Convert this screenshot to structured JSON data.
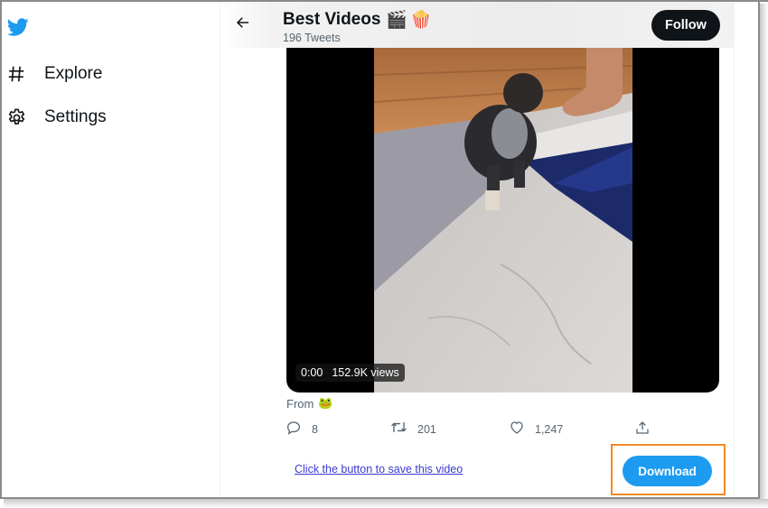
{
  "sidebar": {
    "logo": "twitter-bird-icon",
    "items": [
      {
        "label": "Explore",
        "icon": "hashtag-icon"
      },
      {
        "label": "Settings",
        "icon": "gear-icon"
      }
    ]
  },
  "header": {
    "back_icon": "arrow-left-icon",
    "title": "Best Videos",
    "title_emoji": [
      "🎬",
      "🍿"
    ],
    "subtitle": "196 Tweets",
    "follow_label": "Follow"
  },
  "video": {
    "time": "0:00",
    "views": "152.9K views"
  },
  "tweet": {
    "from_label": "From",
    "from_emoji": "🐸",
    "actions": {
      "reply": {
        "icon": "reply-icon",
        "count": "8"
      },
      "retweet": {
        "icon": "retweet-icon",
        "count": "201"
      },
      "like": {
        "icon": "heart-icon",
        "count": "1,247"
      },
      "share": {
        "icon": "share-icon"
      }
    }
  },
  "download": {
    "link_text": "Click the button to save this video",
    "button_label": "Download"
  },
  "colors": {
    "brand": "#1d9bf0",
    "follow_bg": "#0f1419",
    "highlight": "#f08a24",
    "link": "#3a3ad0",
    "muted_text": "#536471"
  }
}
